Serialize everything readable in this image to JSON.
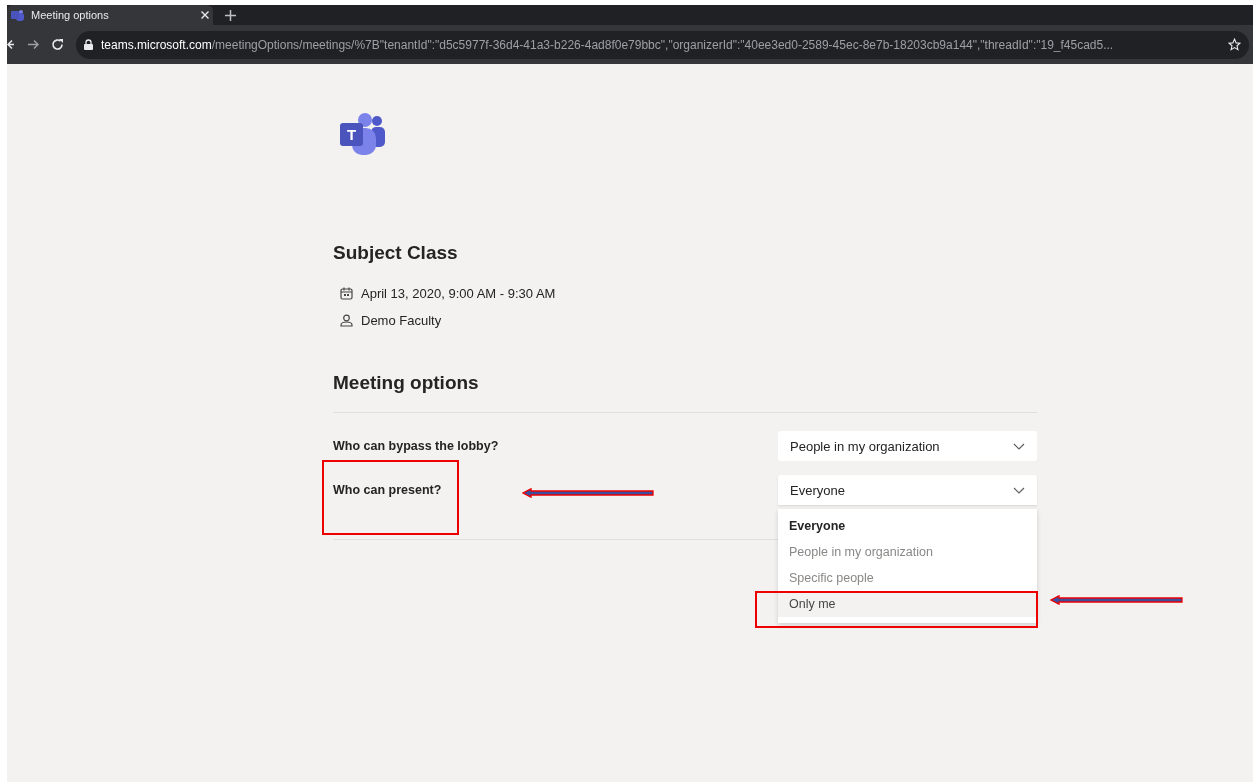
{
  "browser": {
    "tab": {
      "title": "Meeting options",
      "selected": true
    },
    "url": {
      "host": "teams.microsoft.com",
      "path": "/meetingOptions/meetings/%7B\"tenantId\":\"d5c5977f-36d4-41a3-b226-4ad8f0e79bbc\",\"organizerId\":\"40ee3ed0-2589-45ec-8e7b-18203cb9a144\",\"threadId\":\"19_f45cad5..."
    }
  },
  "meeting": {
    "logo_letter": "T",
    "subject": "Subject Class",
    "details": [
      {
        "kind": "date",
        "text": "April 13, 2020, 9:00 AM - 9:30 AM"
      },
      {
        "kind": "organizer",
        "text": "Demo Faculty"
      }
    ]
  },
  "options": {
    "heading": "Meeting options",
    "settings": [
      {
        "label": "Who can bypass the lobby?",
        "value": "People in my organization",
        "expanded": false
      },
      {
        "label": "Who can present?",
        "value": "Everyone",
        "expanded": true,
        "menu": [
          {
            "label": "Everyone",
            "selected": true,
            "highlighted": false
          },
          {
            "label": "People in my organization",
            "selected": false,
            "highlighted": false
          },
          {
            "label": "Specific people",
            "selected": false,
            "highlighted": false
          },
          {
            "label": "Only me",
            "selected": false,
            "highlighted": true
          }
        ]
      }
    ]
  },
  "annotations": [
    {
      "kind": "frame"
    },
    {
      "kind": "arrow"
    },
    {
      "kind": "frame"
    },
    {
      "kind": "arrow"
    }
  ]
}
